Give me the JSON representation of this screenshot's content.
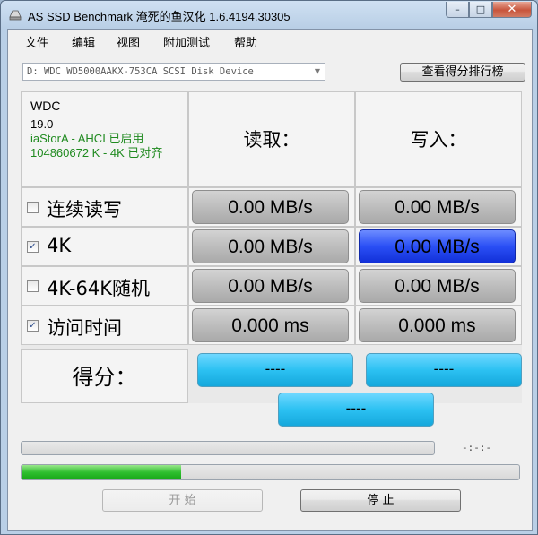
{
  "window": {
    "title": "AS SSD Benchmark 淹死的鱼汉化 1.6.4194.30305",
    "controls": {
      "minimize": "–",
      "maximize": "□",
      "close": "✕"
    }
  },
  "menu": [
    "文件",
    "编辑",
    "视图",
    "附加测试",
    "帮助"
  ],
  "device_select": {
    "value": "D: WDC WD5000AAKX-753CA SCSI Disk Device",
    "arrow": "▼"
  },
  "rank_button": "查看得分排行榜",
  "device_info": {
    "model": "WDC",
    "firmware": "19.0",
    "driver": "iaStorA - AHCI 已启用",
    "alignment": "104860672 K - 4K 已对齐"
  },
  "headers": {
    "read": "读取：",
    "write": "写入："
  },
  "tests": [
    {
      "label": "连续读写",
      "checked": false,
      "read": "0.00 MB/s",
      "write": "0.00 MB/s",
      "active": ""
    },
    {
      "label": "4K",
      "checked": true,
      "read": "0.00 MB/s",
      "write": "0.00 MB/s",
      "active": "write"
    },
    {
      "label": "4K-64K随机",
      "checked": false,
      "read": "0.00 MB/s",
      "write": "0.00 MB/s",
      "active": ""
    },
    {
      "label": "访问时间",
      "checked": true,
      "read": "0.000 ms",
      "write": "0.000 ms",
      "active": ""
    }
  ],
  "score": {
    "label": "得分：",
    "read": "----",
    "write": "----",
    "total": "----"
  },
  "progress": {
    "overall_fraction": 0.0,
    "test_fraction": 0.32,
    "timer": "-:-:-"
  },
  "buttons": {
    "start": "开 始",
    "stop": "停 止"
  },
  "icons": {
    "app": "drive-icon",
    "check": "✓"
  }
}
